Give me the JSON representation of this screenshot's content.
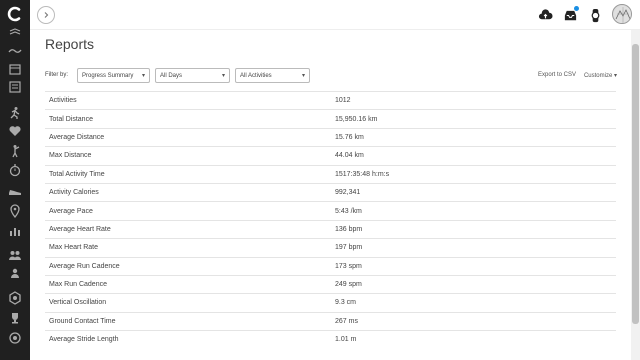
{
  "sidebar": {
    "icons": [
      "logo-icon",
      "layers-icon",
      "activity-wave-icon",
      "calendar-icon",
      "report-list-icon",
      "running-person-icon",
      "heart-icon",
      "golf-person-icon",
      "stopwatch-icon",
      "shoe-icon",
      "location-pin-icon",
      "bar-chart-icon",
      "group-icon",
      "people-icon",
      "badge-icon",
      "trophy-icon",
      "connect-circle-icon"
    ]
  },
  "header": {
    "collapse_icon": "chevron-right-icon",
    "upload_icon": "cloud-upload-icon",
    "inbox_icon": "inbox-icon",
    "device_icon": "watch-icon",
    "avatar": "avatar"
  },
  "page": {
    "title": "Reports",
    "filter_label": "Filter by:",
    "filters": [
      {
        "value": "Progress Summary"
      },
      {
        "value": "All Days"
      },
      {
        "value": "All Activities"
      }
    ],
    "export_label": "Export to CSV",
    "customize_label": "Customize"
  },
  "stats": [
    {
      "label": "Activities",
      "value": "1012"
    },
    {
      "label": "Total Distance",
      "value": "15,950.16 km"
    },
    {
      "label": "Average Distance",
      "value": "15.76 km"
    },
    {
      "label": "Max Distance",
      "value": "44.04 km"
    },
    {
      "label": "Total Activity Time",
      "value": "1517:35:48 h:m:s"
    },
    {
      "label": "Activity Calories",
      "value": "992,341"
    },
    {
      "label": "Average Pace",
      "value": "5:43 /km"
    },
    {
      "label": "Average Heart Rate",
      "value": "136 bpm"
    },
    {
      "label": "Max Heart Rate",
      "value": "197 bpm"
    },
    {
      "label": "Average Run Cadence",
      "value": "173 spm"
    },
    {
      "label": "Max Run Cadence",
      "value": "249 spm"
    },
    {
      "label": "Vertical Oscillation",
      "value": "9.3 cm"
    },
    {
      "label": "Ground Contact Time",
      "value": "267 ms"
    },
    {
      "label": "Average Stride Length",
      "value": "1.01 m"
    }
  ],
  "colors": {
    "sidebar_bg": "#202020",
    "notification_dot": "#1a8fe3"
  }
}
